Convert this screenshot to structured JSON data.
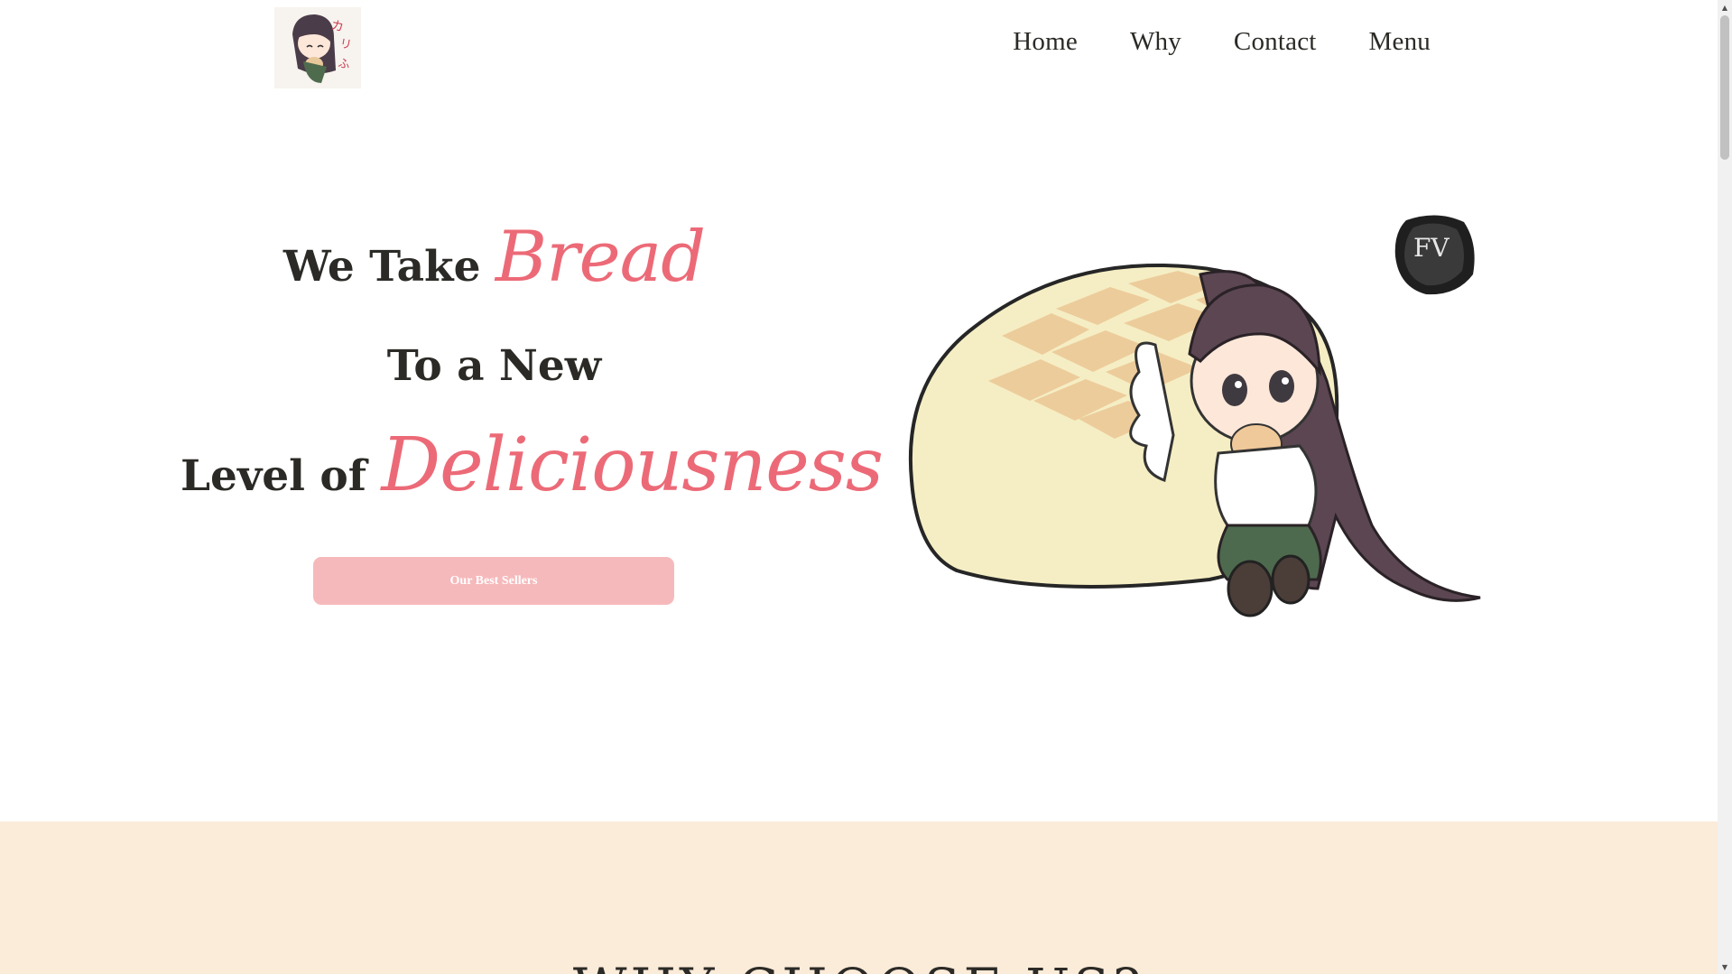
{
  "header": {
    "logo_icon": "chibi-girl-with-bread-logo",
    "nav": [
      "Home",
      "Why",
      "Contact",
      "Menu"
    ]
  },
  "hero": {
    "line1_prefix": "We Take",
    "line1_script": "Bread",
    "line2": "To a New",
    "line3_prefix": "Level of",
    "line3_script": "Deliciousness",
    "cta_label": "Our Best Sellers",
    "illustration_icon": "chibi-girl-with-melon-bread",
    "badge_text": "FV",
    "accent_color": "#ec6a77",
    "cta_color": "#f6b9bb"
  },
  "why": {
    "title": "WHY CHOOSE US?",
    "background_color": "#fbebd9"
  },
  "scrollbar": {
    "up_icon": "▲",
    "down_icon": "▼"
  }
}
